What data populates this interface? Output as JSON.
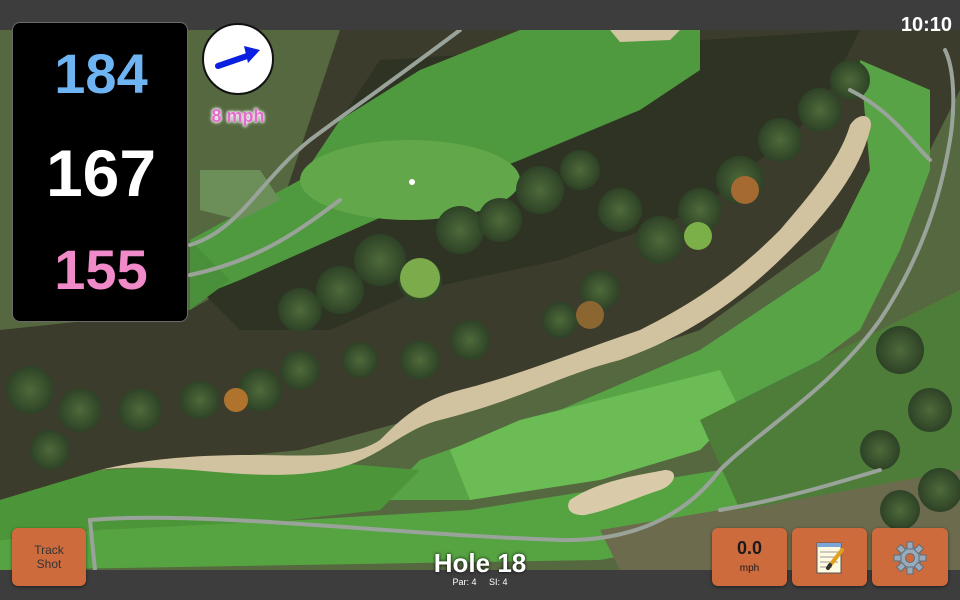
{
  "status_bar": {
    "time": "10:10"
  },
  "distances": {
    "back": "184",
    "middle": "167",
    "front": "155"
  },
  "wind": {
    "speed": "8 mph",
    "direction_icon": "arrow-right-icon"
  },
  "buttons": {
    "track_shot": "Track Shot",
    "speed": {
      "value": "0.0",
      "unit": "mph"
    },
    "notes_icon": "notepad-icon",
    "settings_icon": "gear-icon"
  },
  "hole": {
    "title": "Hole 18",
    "par": "Par: 4",
    "si": "SI: 4"
  },
  "colors": {
    "back_distance": "#6eb4f2",
    "middle_distance": "#ffffff",
    "front_distance": "#f18ac8",
    "wind_text": "#e56ad0",
    "button_bg": "#cd6b3d"
  }
}
